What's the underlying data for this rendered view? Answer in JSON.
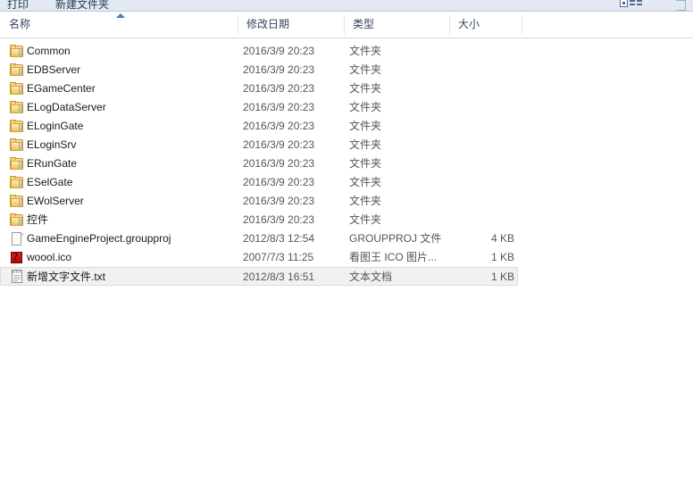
{
  "toolbar": {
    "print_label": "打印",
    "new_folder_label": "新建文件夹",
    "view_mode_icon": "list-view-icon",
    "dropdown_icon": "chevron-down-icon"
  },
  "columns": {
    "name": "名称",
    "date_modified": "修改日期",
    "type": "类型",
    "size": "大小",
    "sort_indicator": "ascending-sort-icon"
  },
  "colors": {
    "toolbar_bg": "#e2e9f3",
    "header_text": "#33465c",
    "name_text": "#1a1a1a",
    "meta_text": "#555555",
    "selection_bg": "#f1f1f1",
    "selection_border": "#dcdcdc",
    "folder_icon": "#f2c75c",
    "ico_icon": "#c01010"
  },
  "files": [
    {
      "name": "Common",
      "date": "2016/3/9 20:23",
      "type": "文件夹",
      "size": "",
      "icon": "folder",
      "selected": false
    },
    {
      "name": "EDBServer",
      "date": "2016/3/9 20:23",
      "type": "文件夹",
      "size": "",
      "icon": "folder",
      "selected": false
    },
    {
      "name": "EGameCenter",
      "date": "2016/3/9 20:23",
      "type": "文件夹",
      "size": "",
      "icon": "folder",
      "selected": false
    },
    {
      "name": "ELogDataServer",
      "date": "2016/3/9 20:23",
      "type": "文件夹",
      "size": "",
      "icon": "folder",
      "selected": false
    },
    {
      "name": "ELoginGate",
      "date": "2016/3/9 20:23",
      "type": "文件夹",
      "size": "",
      "icon": "folder",
      "selected": false
    },
    {
      "name": "ELoginSrv",
      "date": "2016/3/9 20:23",
      "type": "文件夹",
      "size": "",
      "icon": "folder",
      "selected": false
    },
    {
      "name": "ERunGate",
      "date": "2016/3/9 20:23",
      "type": "文件夹",
      "size": "",
      "icon": "folder",
      "selected": false
    },
    {
      "name": "ESelGate",
      "date": "2016/3/9 20:23",
      "type": "文件夹",
      "size": "",
      "icon": "folder",
      "selected": false
    },
    {
      "name": "EWolServer",
      "date": "2016/3/9 20:23",
      "type": "文件夹",
      "size": "",
      "icon": "folder",
      "selected": false
    },
    {
      "name": "控件",
      "date": "2016/3/9 20:23",
      "type": "文件夹",
      "size": "",
      "icon": "folder",
      "selected": false
    },
    {
      "name": "GameEngineProject.groupproj",
      "date": "2012/8/3 12:54",
      "type": "GROUPPROJ 文件",
      "size": "4 KB",
      "icon": "doc",
      "selected": false
    },
    {
      "name": "woool.ico",
      "date": "2007/7/3 11:25",
      "type": "看图王 ICO 图片...",
      "size": "1 KB",
      "icon": "ico",
      "selected": false
    },
    {
      "name": "新增文字文件.txt",
      "date": "2012/8/3 16:51",
      "type": "文本文档",
      "size": "1 KB",
      "icon": "text",
      "selected": true
    }
  ]
}
